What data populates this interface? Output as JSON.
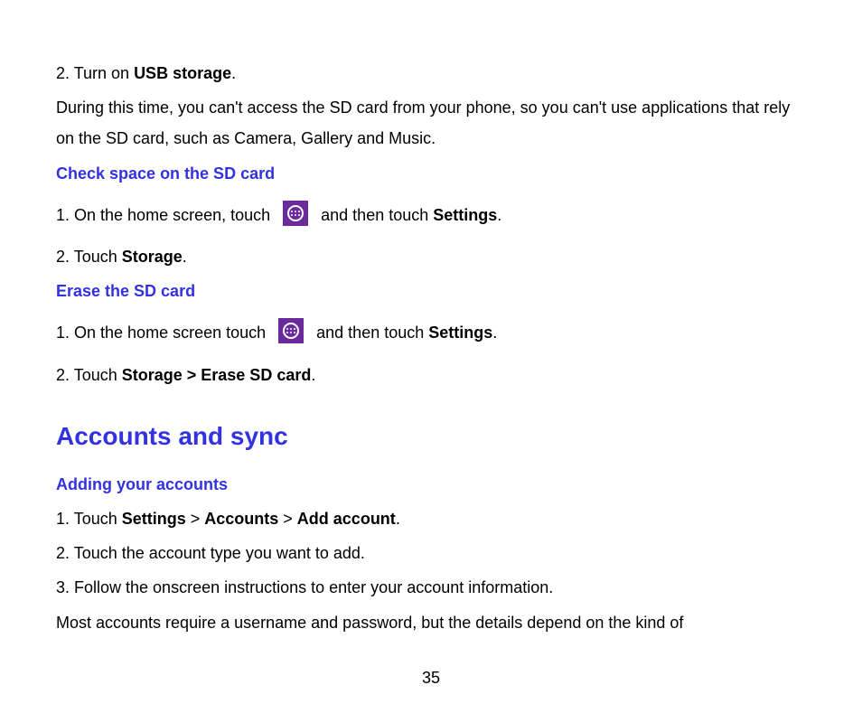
{
  "usb": {
    "step2_prefix": "2. Turn on ",
    "step2_bold": "USB storage",
    "step2_suffix": ".",
    "note": "During this time, you can't access the SD card from your phone, so you can't use applications that rely on the SD card, such as Camera, Gallery and Music."
  },
  "check_sd": {
    "heading": "Check space on the SD card",
    "step1_prefix": "1. On the home screen, touch  ",
    "step1_mid": "  and then touch ",
    "step1_bold": "Settings",
    "step1_suffix": ".",
    "step2_prefix": "2. Touch ",
    "step2_bold": "Storage",
    "step2_suffix": "."
  },
  "erase_sd": {
    "heading": "Erase the SD card",
    "step1_prefix": "1. On the home screen touch  ",
    "step1_mid": "  and then touch ",
    "step1_bold": "Settings",
    "step1_suffix": ".",
    "step2_prefix": "2. Touch ",
    "step2_bold": "Storage > Erase SD card",
    "step2_suffix": "."
  },
  "accounts": {
    "heading": "Accounts and sync",
    "sub": "Adding your accounts",
    "step1_prefix": "1. Touch ",
    "step1_b1": "Settings",
    "step1_sep1": " > ",
    "step1_b2": "Accounts",
    "step1_sep2": " > ",
    "step1_b3": "Add account",
    "step1_suffix": ".",
    "step2": "2. Touch the account type you want to add.",
    "step3": "3. Follow the onscreen instructions to enter your account information.",
    "note": "Most accounts require a username and password, but the details depend on the kind of"
  },
  "page_number": "35"
}
